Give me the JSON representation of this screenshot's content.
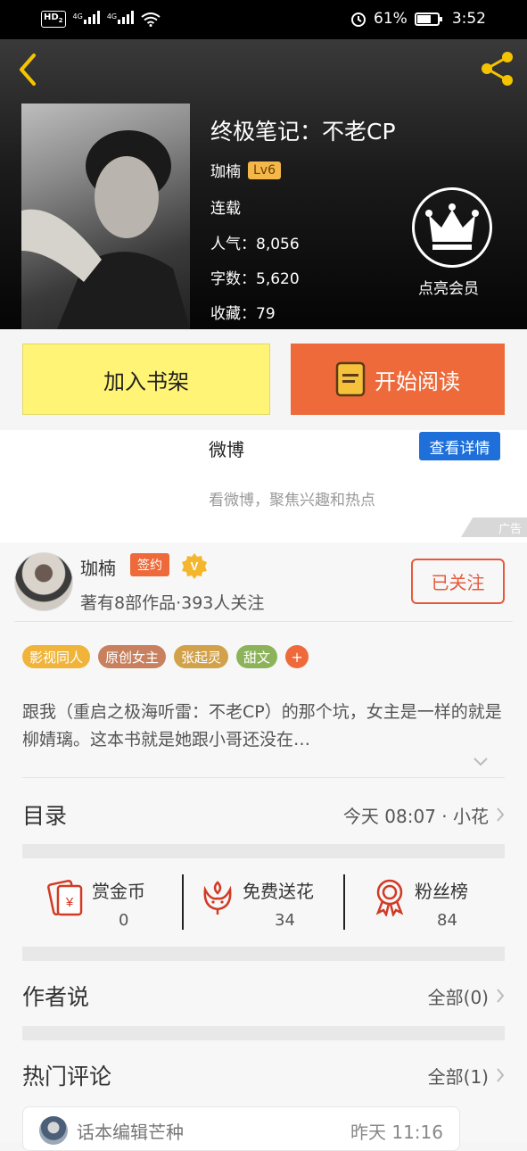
{
  "status_bar": {
    "hd": "HD",
    "hd_sub": "2",
    "sig1": "4G",
    "sig2": "4G",
    "battery_pct": "61%",
    "time": "3:52"
  },
  "header": {
    "title": "终极笔记：不老CP",
    "author": "珈楠",
    "level": "Lv6",
    "status": "连载",
    "popularity": "人气：8,056",
    "words": "字数：5,620",
    "favorites": "收藏：79",
    "vip_label": "点亮会员"
  },
  "actions": {
    "add_shelf": "加入书架",
    "start_read": "开始阅读"
  },
  "ad": {
    "title": "微博",
    "button": "查看详情",
    "desc": "看微博，聚焦兴趣和热点",
    "tag": "广告"
  },
  "author": {
    "name": "珈楠",
    "sign_badge": "签约",
    "info": "著有8部作品·393人关注",
    "follow_button": "已关注"
  },
  "tags": [
    {
      "label": "影视同人",
      "color": "#f0b43a"
    },
    {
      "label": "原创女主",
      "color": "#c8805f"
    },
    {
      "label": "张起灵",
      "color": "#d2a24a"
    },
    {
      "label": "甜文",
      "color": "#8db35a"
    }
  ],
  "tag_more": "+",
  "synopsis": "跟我（重启之极海听雷：不老CP）的那个坑，女主是一样的就是柳婧璃。这本书就是她跟小哥还没在…",
  "catalog": {
    "title": "目录",
    "latest": "今天 08:07 · 小花"
  },
  "gifts": [
    {
      "name": "赏金币",
      "value": "0",
      "icon": "red-envelope-icon"
    },
    {
      "name": "免费送花",
      "value": "34",
      "icon": "flower-icon"
    },
    {
      "name": "粉丝榜",
      "value": "84",
      "icon": "medal-icon"
    }
  ],
  "author_says": {
    "title": "作者说",
    "count": "全部(0)"
  },
  "hot_comments": {
    "title": "热门评论",
    "count": "全部(1)",
    "first": {
      "user": "话本编辑芒种",
      "time": "昨天 11:16"
    }
  },
  "colors": {
    "accent_orange": "#ee6a3a",
    "shelf_yellow": "#fff475",
    "ad_blue": "#1e6fd9",
    "vip_gold": "#f3b74a"
  }
}
